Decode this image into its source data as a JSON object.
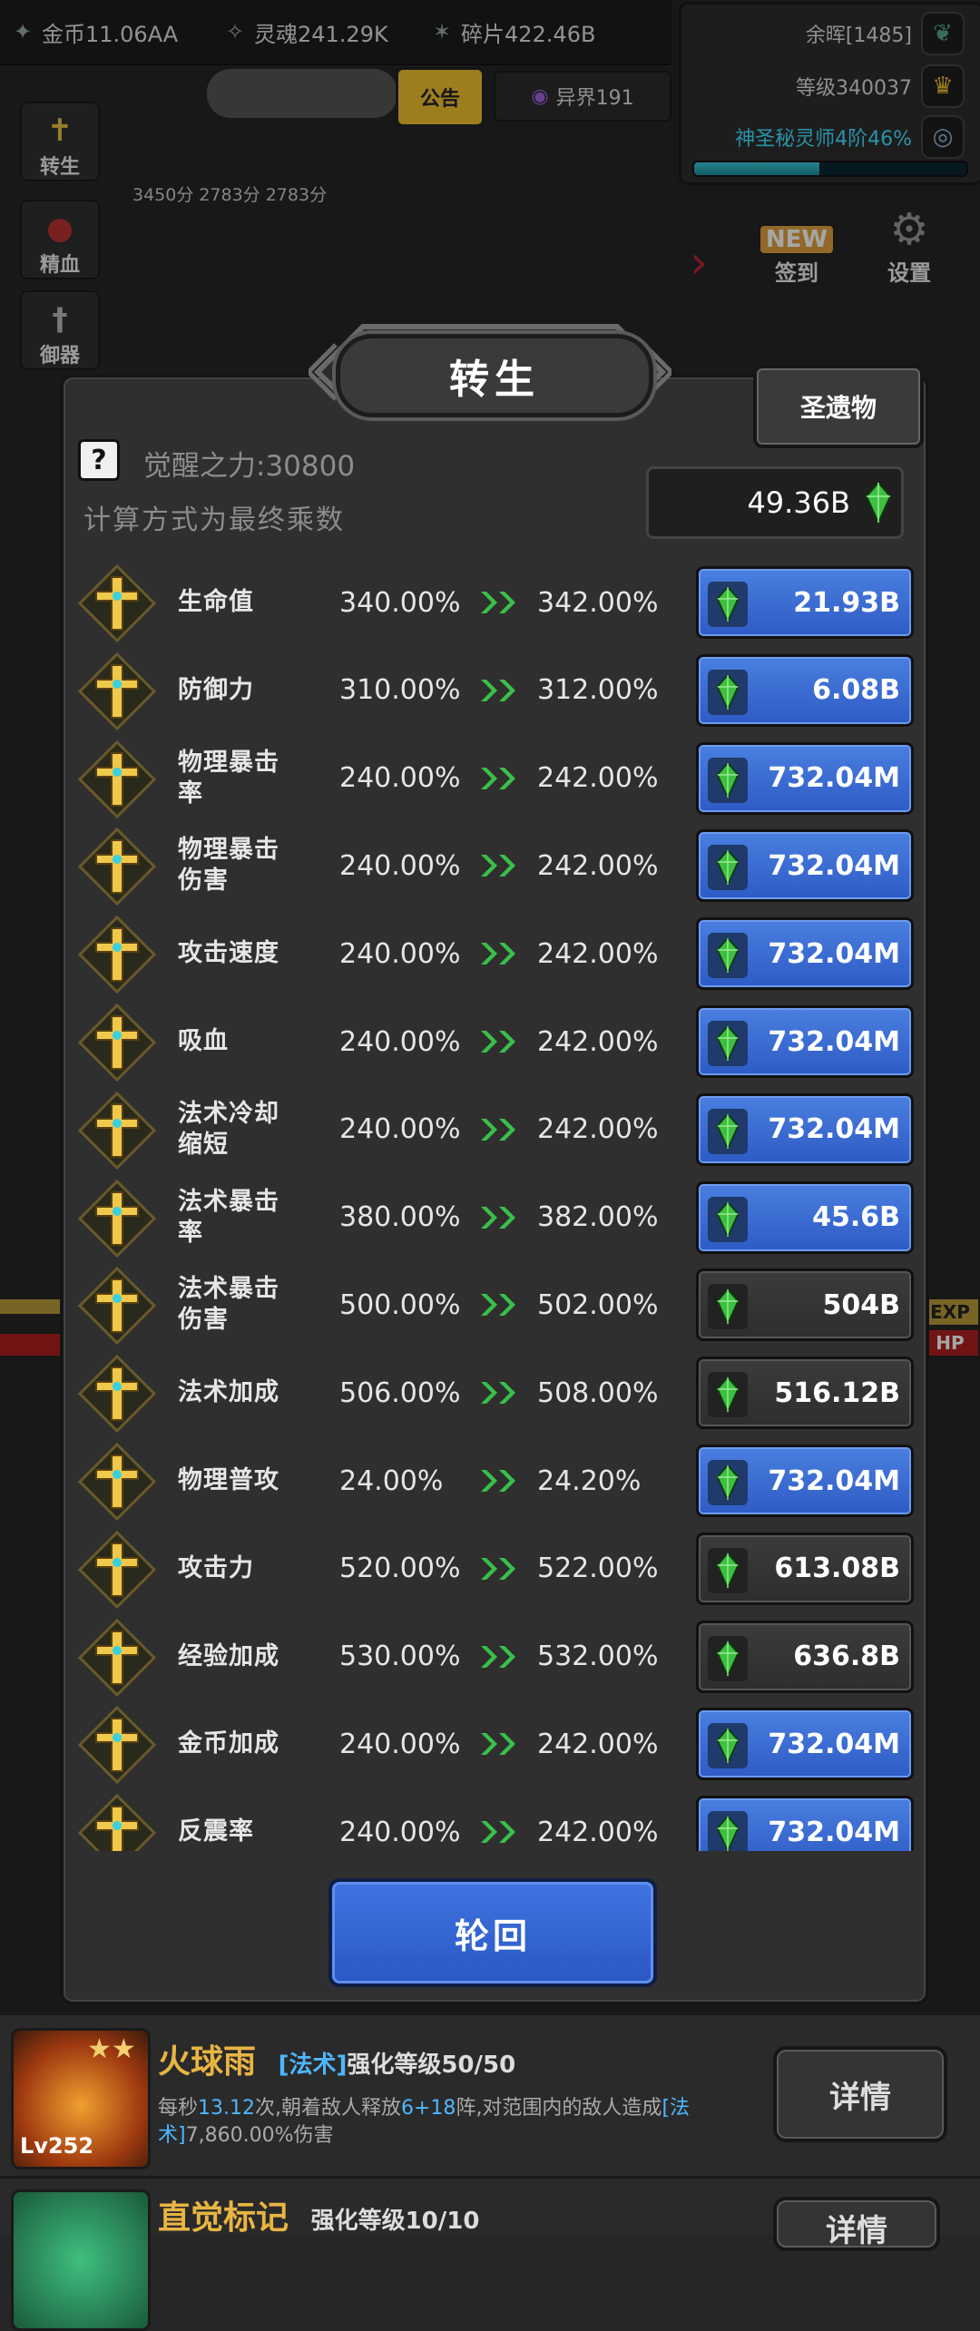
{
  "resources": [
    {
      "icon": "coin-icon",
      "label": "金币11.06AA"
    },
    {
      "icon": "soul-icon",
      "label": "灵魂241.29K"
    },
    {
      "icon": "shard-icon",
      "label": "碎片422.46B"
    }
  ],
  "stats": {
    "glow": "余晖[1485]",
    "level": "等级340037",
    "rank": "神圣秘灵师4阶46%",
    "rank_progress": 0.46
  },
  "announcement": "公告",
  "otherworld": "异界191",
  "buffs": [
    "3450分",
    "2783分",
    "2783分"
  ],
  "left_menu": [
    "转生",
    "精血",
    "御器"
  ],
  "right_menu": [
    {
      "label": "签到",
      "badge": "NEW"
    },
    {
      "label": "设置"
    }
  ],
  "background_labels": {
    "exp": "EXP",
    "hp": "HP"
  },
  "modal": {
    "title": "转生",
    "relic_button": "圣遗物",
    "help": "?",
    "awaken_power": "觉醒之力:30800",
    "calc_note": "计算方式为最终乘数",
    "currency_amount": "49.36B",
    "rows": [
      {
        "name": "生命值",
        "current": "340.00%",
        "next": "342.00%",
        "cost": "21.93B",
        "affordable": true
      },
      {
        "name": "防御力",
        "current": "310.00%",
        "next": "312.00%",
        "cost": "6.08B",
        "affordable": true
      },
      {
        "name": "物理暴击率",
        "current": "240.00%",
        "next": "242.00%",
        "cost": "732.04M",
        "affordable": true
      },
      {
        "name": "物理暴击伤害",
        "current": "240.00%",
        "next": "242.00%",
        "cost": "732.04M",
        "affordable": true
      },
      {
        "name": "攻击速度",
        "current": "240.00%",
        "next": "242.00%",
        "cost": "732.04M",
        "affordable": true
      },
      {
        "name": "吸血",
        "current": "240.00%",
        "next": "242.00%",
        "cost": "732.04M",
        "affordable": true
      },
      {
        "name": "法术冷却缩短",
        "current": "240.00%",
        "next": "242.00%",
        "cost": "732.04M",
        "affordable": true
      },
      {
        "name": "法术暴击率",
        "current": "380.00%",
        "next": "382.00%",
        "cost": "45.6B",
        "affordable": true
      },
      {
        "name": "法术暴击伤害",
        "current": "500.00%",
        "next": "502.00%",
        "cost": "504B",
        "affordable": false
      },
      {
        "name": "法术加成",
        "current": "506.00%",
        "next": "508.00%",
        "cost": "516.12B",
        "affordable": false
      },
      {
        "name": "物理普攻",
        "current": "24.00%",
        "next": "24.20%",
        "cost": "732.04M",
        "affordable": true
      },
      {
        "name": "攻击力",
        "current": "520.00%",
        "next": "522.00%",
        "cost": "613.08B",
        "affordable": false
      },
      {
        "name": "经验加成",
        "current": "530.00%",
        "next": "532.00%",
        "cost": "636.8B",
        "affordable": false
      },
      {
        "name": "金币加成",
        "current": "240.00%",
        "next": "242.00%",
        "cost": "732.04M",
        "affordable": true
      },
      {
        "name": "反震率",
        "current": "240.00%",
        "next": "242.00%",
        "cost": "732.04M",
        "affordable": true
      }
    ],
    "rebirth_button": "轮回"
  },
  "skills": [
    {
      "name": "火球雨",
      "tag": "[法术]",
      "enhance": "强化等级50/50",
      "level": "Lv252",
      "desc_parts": [
        "每秒",
        "13.12",
        "次,朝着敌人释放",
        "6+18",
        "阵,对范围内的敌人造成",
        "[法术]",
        "7,860.00%",
        "伤害"
      ],
      "detail": "详情"
    },
    {
      "name": "直觉标记",
      "enhance": "强化等级10/10",
      "detail": "详情"
    }
  ]
}
